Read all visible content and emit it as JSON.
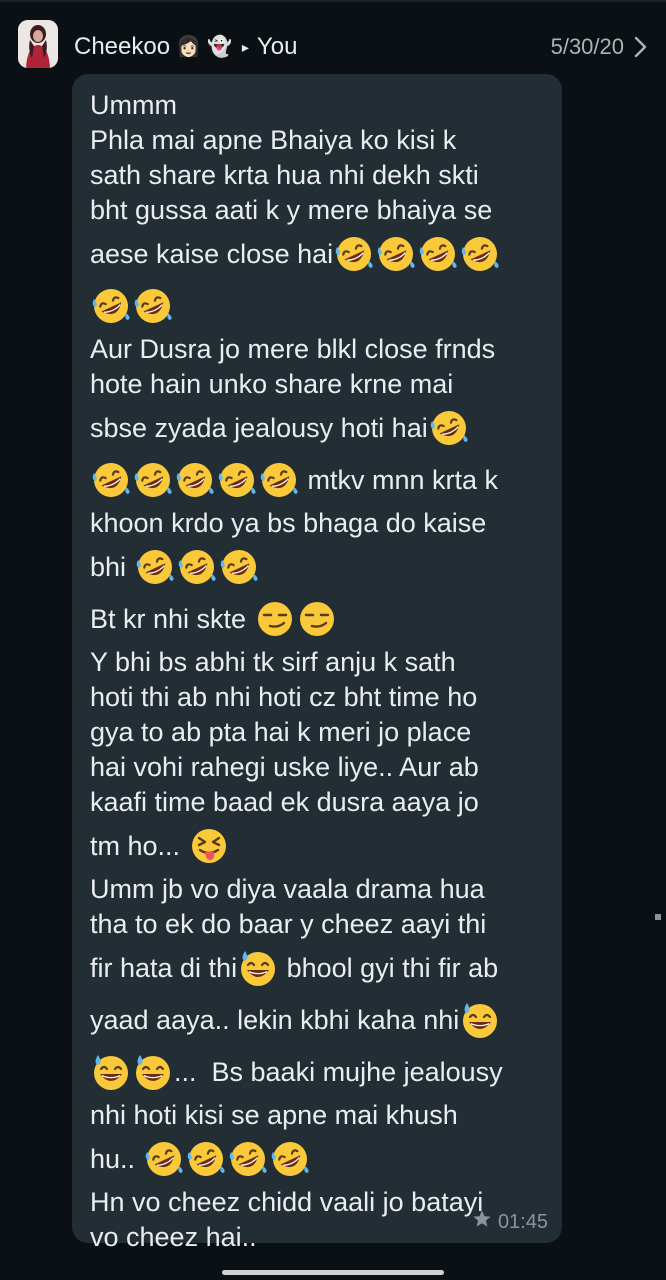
{
  "header": {
    "sender": "Cheekoo",
    "sender_emojis": [
      "woman-emoji",
      "ghost-emoji"
    ],
    "recipient": "You",
    "date": "5/30/20"
  },
  "message": {
    "lines": [
      {
        "segs": [
          {
            "t": "Ummm"
          }
        ]
      },
      {
        "segs": [
          {
            "t": "Phla mai apne Bhaiya ko kisi k"
          }
        ]
      },
      {
        "segs": [
          {
            "t": "sath share krta hua nhi dekh skti"
          }
        ]
      },
      {
        "segs": [
          {
            "t": "bht gussa aati k y mere bhaiya se"
          }
        ]
      },
      {
        "tall": true,
        "segs": [
          {
            "t": "aese kaise close hai"
          },
          {
            "e": "rofl"
          },
          {
            "e": "rofl"
          },
          {
            "e": "rofl"
          },
          {
            "e": "rofl"
          }
        ]
      },
      {
        "tall": true,
        "segs": [
          {
            "e": "rofl"
          },
          {
            "e": "rofl"
          }
        ]
      },
      {
        "segs": [
          {
            "t": "Aur Dusra jo mere blkl close frnds"
          }
        ]
      },
      {
        "segs": [
          {
            "t": "hote hain unko share krne mai"
          }
        ]
      },
      {
        "tall": true,
        "segs": [
          {
            "t": "sbse zyada jealousy hoti hai"
          },
          {
            "e": "rofl"
          }
        ]
      },
      {
        "tall": true,
        "segs": [
          {
            "e": "rofl"
          },
          {
            "e": "rofl"
          },
          {
            "e": "rofl"
          },
          {
            "e": "rofl"
          },
          {
            "e": "rofl"
          },
          {
            "t": " mtkv mnn krta k"
          }
        ]
      },
      {
        "segs": [
          {
            "t": "khoon krdo ya bs bhaga do kaise"
          }
        ]
      },
      {
        "tall": true,
        "segs": [
          {
            "t": "bhi "
          },
          {
            "e": "rofl"
          },
          {
            "e": "rofl"
          },
          {
            "e": "rofl"
          }
        ]
      },
      {
        "tall": true,
        "segs": [
          {
            "t": "Bt kr nhi skte "
          },
          {
            "e": "smirk"
          },
          {
            "e": "smirk"
          }
        ]
      },
      {
        "segs": [
          {
            "t": "Y bhi bs abhi tk sirf anju k sath"
          }
        ]
      },
      {
        "segs": [
          {
            "t": "hoti thi ab nhi hoti cz bht time ho"
          }
        ]
      },
      {
        "segs": [
          {
            "t": "gya to ab pta hai k meri jo place"
          }
        ]
      },
      {
        "segs": [
          {
            "t": "hai vohi rahegi uske liye.. Aur ab"
          }
        ]
      },
      {
        "segs": [
          {
            "t": "kaafi time baad ek dusra aaya jo"
          }
        ]
      },
      {
        "tall": true,
        "segs": [
          {
            "t": "tm ho... "
          },
          {
            "e": "tongue"
          }
        ]
      },
      {
        "segs": [
          {
            "t": "Umm jb vo diya vaala drama hua"
          }
        ]
      },
      {
        "segs": [
          {
            "t": "tha to ek do baar y cheez aayi thi"
          }
        ]
      },
      {
        "tall": true,
        "segs": [
          {
            "t": "fir hata di thi"
          },
          {
            "e": "sweat"
          },
          {
            "t": " bhool gyi thi fir ab"
          }
        ]
      },
      {
        "tall": true,
        "segs": [
          {
            "t": "yaad aaya.. lekin kbhi kaha nhi"
          },
          {
            "e": "sweat"
          }
        ]
      },
      {
        "tall": true,
        "segs": [
          {
            "e": "sweat"
          },
          {
            "e": "sweat"
          },
          {
            "t": "...  Bs baaki mujhe jealousy"
          }
        ]
      },
      {
        "segs": [
          {
            "t": "nhi hoti kisi se apne mai khush"
          }
        ]
      },
      {
        "tall": true,
        "segs": [
          {
            "t": "hu.. "
          },
          {
            "e": "rofl"
          },
          {
            "e": "rofl"
          },
          {
            "e": "rofl"
          },
          {
            "e": "rofl"
          }
        ]
      },
      {
        "segs": [
          {
            "t": "Hn vo cheez chidd vaali jo batayi"
          }
        ]
      },
      {
        "segs": [
          {
            "t": "vo cheez hai.."
          }
        ]
      }
    ],
    "time": "01:45",
    "starred": true
  },
  "colors": {
    "background": "#0b1014",
    "bubble": "#232d34",
    "text": "#e9edef",
    "meta": "#8b9499"
  }
}
